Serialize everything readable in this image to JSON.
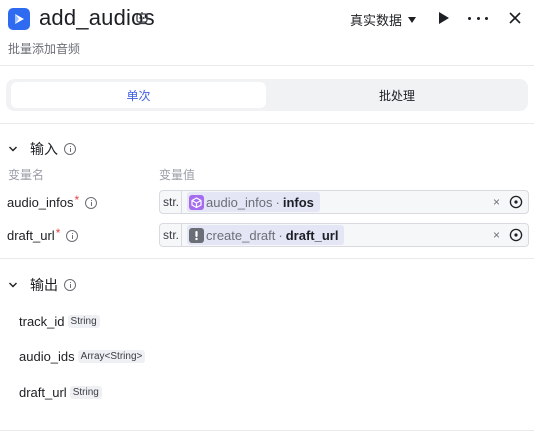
{
  "header": {
    "title": "add_audios",
    "subtitle": "批量添加音频",
    "mode_label": "真实数据",
    "icons": {
      "logo": "app-logo-icon",
      "badge": "robot-icon",
      "run": "play-icon",
      "more": "more-icon",
      "close": "close-icon"
    }
  },
  "tabs": [
    {
      "label": "单次",
      "active": true
    },
    {
      "label": "批处理",
      "active": false
    }
  ],
  "input_section": {
    "label": "输入",
    "col_name": "变量名",
    "col_value": "变量值",
    "rows": [
      {
        "name": "audio_infos",
        "required": "*",
        "type": "str.",
        "ref_node": "audio_infos",
        "ref_sep": "·",
        "ref_field": "infos",
        "node_icon": "purple-cube-icon",
        "clear": "×"
      },
      {
        "name": "draft_url",
        "required": "*",
        "type": "str.",
        "ref_node": "create_draft",
        "ref_sep": "·",
        "ref_field": "draft_url",
        "node_icon": "gray-exclamation-icon",
        "clear": "×"
      }
    ]
  },
  "output_section": {
    "label": "输出",
    "rows": [
      {
        "name": "track_id",
        "type": "String"
      },
      {
        "name": "audio_ids",
        "type": "Array<String>"
      },
      {
        "name": "draft_url",
        "type": "String"
      }
    ]
  },
  "colors": {
    "accent": "#3f5fe0",
    "logo": "#2f6bf0",
    "required": "#e54545",
    "node_purple": "#a56cf0"
  }
}
